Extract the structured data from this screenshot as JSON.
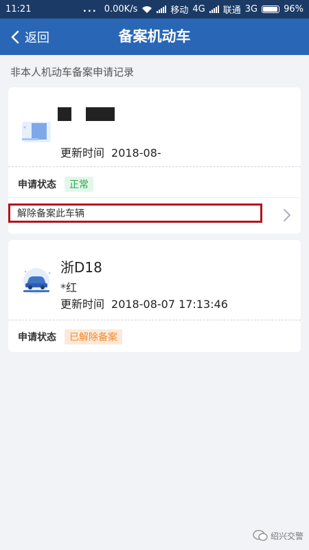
{
  "status_bar": {
    "time": "11:21",
    "dots": "...",
    "speed": "0.00K/s",
    "carrier1": "移动",
    "net1": "4G",
    "carrier2": "联通",
    "net2": "3G",
    "battery": "96%"
  },
  "nav": {
    "back_label": "返回",
    "title": "备案机动车"
  },
  "section": {
    "caption": "非本人机动车备案申请记录"
  },
  "records": [
    {
      "update_label": "更新时间",
      "update_value": "2018-08-",
      "status_label": "申请状态",
      "status_value": "正常",
      "status_color": "#2aa552",
      "action_label": "解除备案此车辆"
    },
    {
      "plate": "浙D18",
      "color": "*红",
      "update_label": "更新时间",
      "update_value": "2018-08-07 17:13:46",
      "status_label": "申请状态",
      "status_value": "已解除备案",
      "status_color": "#f08a2c"
    }
  ],
  "watermark": {
    "text": "绍兴交警"
  },
  "colors": {
    "nav_background": "#2966b6",
    "status_bar_background": "#1b3a66",
    "highlight_border": "#b5121b"
  }
}
